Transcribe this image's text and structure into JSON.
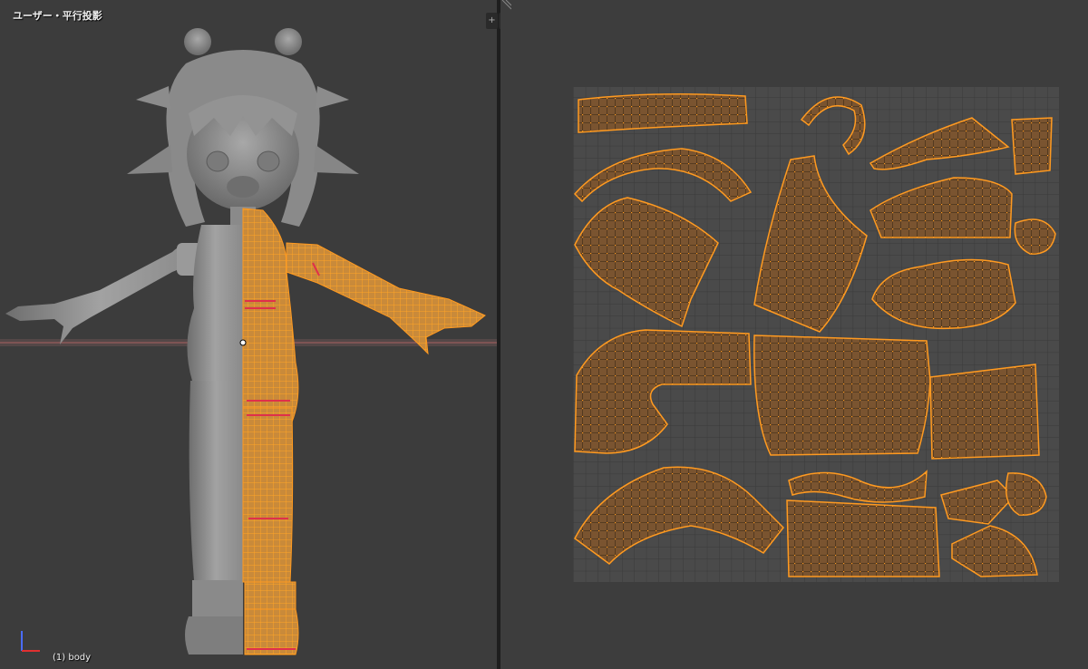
{
  "viewport": {
    "view_name": "ユーザー・平行投影",
    "object_info": "(1) body"
  },
  "split_widget": {
    "left_icon": "+",
    "right_icon": "+"
  },
  "colors": {
    "viewport_bg": "#3c3c3c",
    "uv_bg": "#3d3d3d",
    "grid_bg": "#4a4a4a",
    "mesh_gray": "#8c8c8c",
    "selected_orange": "#ff8c19",
    "island_fill": "#7a5430",
    "seam_red": "#e0304a"
  },
  "icons": [
    "axis-gizmo-icon",
    "split-area-icon",
    "area-corner-icon"
  ]
}
